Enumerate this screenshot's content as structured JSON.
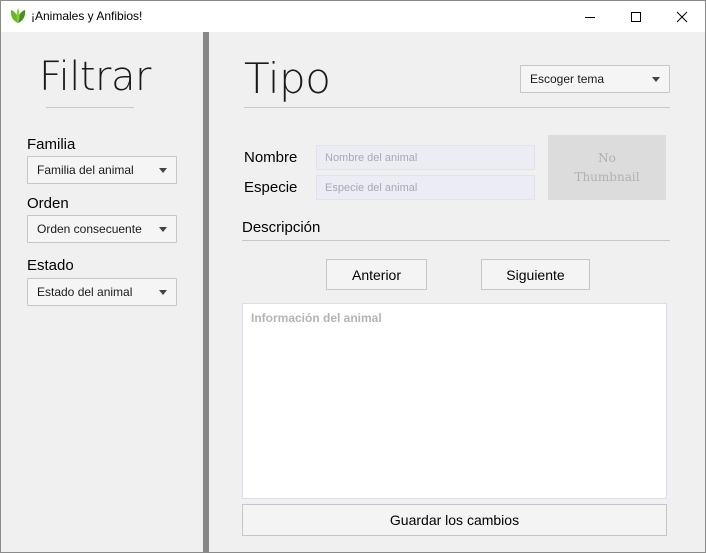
{
  "window": {
    "title": "¡Animales y Anfibios!"
  },
  "sidebar": {
    "title": "Filtrar",
    "filters": [
      {
        "label": "Familia",
        "value": "Familia del animal"
      },
      {
        "label": "Orden",
        "value": "Orden consecuente"
      },
      {
        "label": "Estado",
        "value": "Estado del animal"
      }
    ]
  },
  "main": {
    "title": "Tipo",
    "theme_select": "Escoger tema",
    "name_label": "Nombre",
    "name_placeholder": "Nombre del animal",
    "species_label": "Especie",
    "species_placeholder": "Especie del animal",
    "thumbnail_text": "No Thumbnail",
    "description_label": "Descripción",
    "prev_button": "Anterior",
    "next_button": "Siguiente",
    "info_placeholder": "Información del animal",
    "save_button": "Guardar los cambios"
  },
  "icons": {
    "app": "leaf-icon",
    "minimize": "minimize-icon",
    "maximize": "maximize-icon",
    "close": "close-icon"
  },
  "colors": {
    "app_icon_green": "#5aa32a",
    "divider": "#888888",
    "thumbnail_bg": "#dcdcdc"
  }
}
